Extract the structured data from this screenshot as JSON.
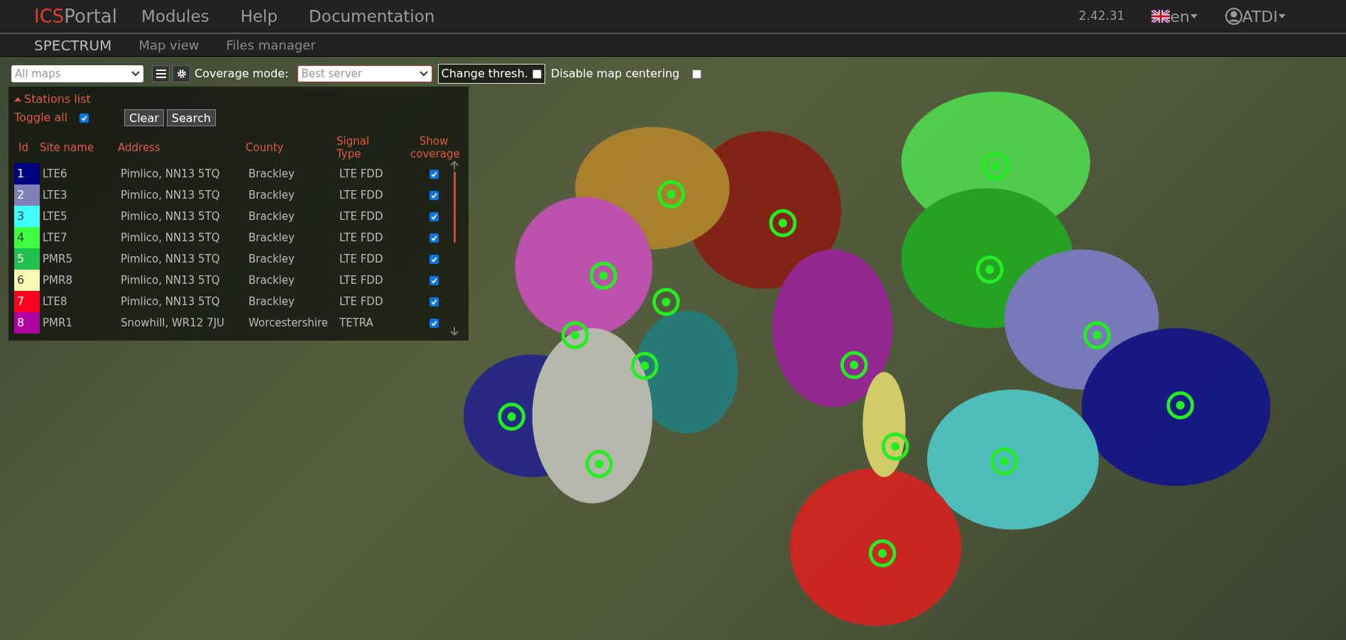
{
  "navbar": {
    "brand_prefix": "ICS",
    "brand_suffix": "Portal",
    "menu": [
      "Modules",
      "Help",
      "Documentation"
    ],
    "version": "2.42.31",
    "language": "en",
    "user": "ATDI"
  },
  "subnav": {
    "items": [
      {
        "label": "SPECTRUM",
        "selected": true
      },
      {
        "label": "Map view",
        "selected": false
      },
      {
        "label": "Files manager",
        "selected": false
      }
    ]
  },
  "toolbar": {
    "map_select": "All maps",
    "coverage_label": "Coverage mode:",
    "coverage_mode": "Best server",
    "change_thresh": {
      "label": "Change thresh.",
      "checked": false
    },
    "disable_centering": {
      "label": "Disable map centering",
      "checked": false
    }
  },
  "stations_panel": {
    "title": "Stations list",
    "expanded": true,
    "toggle_all": {
      "label": "Toggle all",
      "checked": true
    },
    "buttons": [
      "Clear",
      "Search"
    ],
    "columns": [
      "Id",
      "Site name",
      "Address",
      "County",
      "Signal Type",
      "Show coverage"
    ],
    "rows": [
      {
        "id": "1",
        "site": "LTE6",
        "address": "Pimlico, NN13 5TQ",
        "county": "Brackley",
        "type": "LTE FDD",
        "color": "#000080",
        "show": true
      },
      {
        "id": "2",
        "site": "LTE3",
        "address": "Pimlico, NN13 5TQ",
        "county": "Brackley",
        "type": "LTE FDD",
        "color": "#8080b8",
        "show": true
      },
      {
        "id": "3",
        "site": "LTE5",
        "address": "Pimlico, NN13 5TQ",
        "county": "Brackley",
        "type": "LTE FDD",
        "color": "#40ffff",
        "show": true
      },
      {
        "id": "4",
        "site": "LTE7",
        "address": "Pimlico, NN13 5TQ",
        "county": "Brackley",
        "type": "LTE FDD",
        "color": "#40ff40",
        "show": true
      },
      {
        "id": "5",
        "site": "PMR5",
        "address": "Pimlico, NN13 5TQ",
        "county": "Brackley",
        "type": "LTE FDD",
        "color": "#20c050",
        "show": true
      },
      {
        "id": "6",
        "site": "PMR8",
        "address": "Pimlico, NN13 5TQ",
        "county": "Brackley",
        "type": "LTE FDD",
        "color": "#f8f8b0",
        "show": true
      },
      {
        "id": "7",
        "site": "LTE8",
        "address": "Pimlico, NN13 5TQ",
        "county": "Brackley",
        "type": "LTE FDD",
        "color": "#ff0020",
        "show": true
      },
      {
        "id": "8",
        "site": "PMR1",
        "address": "Snowhill, WR12 7JU",
        "county": "Worcestershire",
        "type": "TETRA",
        "color": "#b000a0",
        "show": true
      }
    ]
  }
}
